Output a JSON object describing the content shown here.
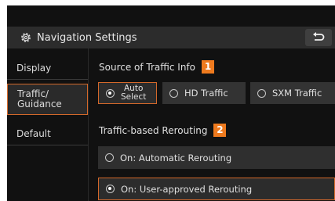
{
  "header": {
    "title": "Navigation Settings",
    "icons": {
      "settings": "gear-icon",
      "back": "back-arrow-icon"
    }
  },
  "sidebar": {
    "items": [
      {
        "label": "Display",
        "selected": false
      },
      {
        "label_line1": "Traffic/",
        "label_line2": "Guidance",
        "selected": true
      },
      {
        "label": "Default",
        "selected": false
      }
    ]
  },
  "traffic_source": {
    "title": "Source of Traffic Info",
    "badge": "1",
    "options": [
      {
        "label_line1": "Auto",
        "label_line2": "Select",
        "selected": true
      },
      {
        "label": "HD Traffic",
        "selected": false
      },
      {
        "label": "SXM Traffic",
        "selected": false
      }
    ]
  },
  "rerouting": {
    "title": "Traffic-based Rerouting",
    "badge": "2",
    "options": [
      {
        "label": "On: Automatic Rerouting",
        "selected": false
      },
      {
        "label": "On: User-approved Rerouting",
        "selected": true
      }
    ]
  },
  "colors": {
    "accent": "#d4682a",
    "badge": "#ee7a1e",
    "background": "#111111",
    "header": "#2c2c2c",
    "option": "#333333"
  }
}
